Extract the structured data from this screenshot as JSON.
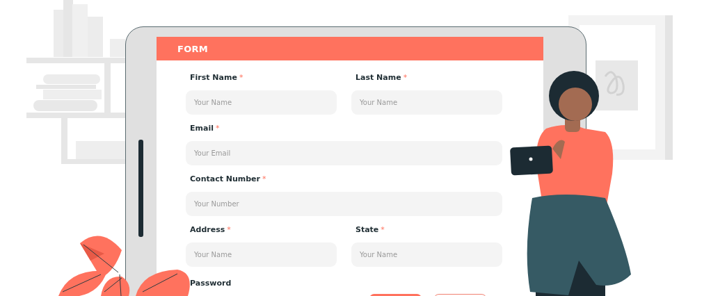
{
  "form": {
    "title": "FORM",
    "fields": [
      {
        "label": "First Name",
        "required_mark": "*",
        "placeholder": "Your Name",
        "kind": "half"
      },
      {
        "label": "Last Name",
        "required_mark": "*",
        "placeholder": "Your Name",
        "kind": "half"
      },
      {
        "label": "Email",
        "required_mark": "*",
        "placeholder": "Your Email",
        "kind": "full"
      },
      {
        "label": "Contact Number",
        "required_mark": "*",
        "placeholder": "Your Number",
        "kind": "full"
      },
      {
        "label": "Address",
        "required_mark": "*",
        "placeholder": "Your Name",
        "kind": "half"
      },
      {
        "label": "State",
        "required_mark": "*",
        "placeholder": "Your Name",
        "kind": "half"
      },
      {
        "label": "Password",
        "kind": "half"
      }
    ],
    "buttons": [
      {
        "kind": "filled"
      },
      {
        "kind": "outlined"
      }
    ]
  }
}
